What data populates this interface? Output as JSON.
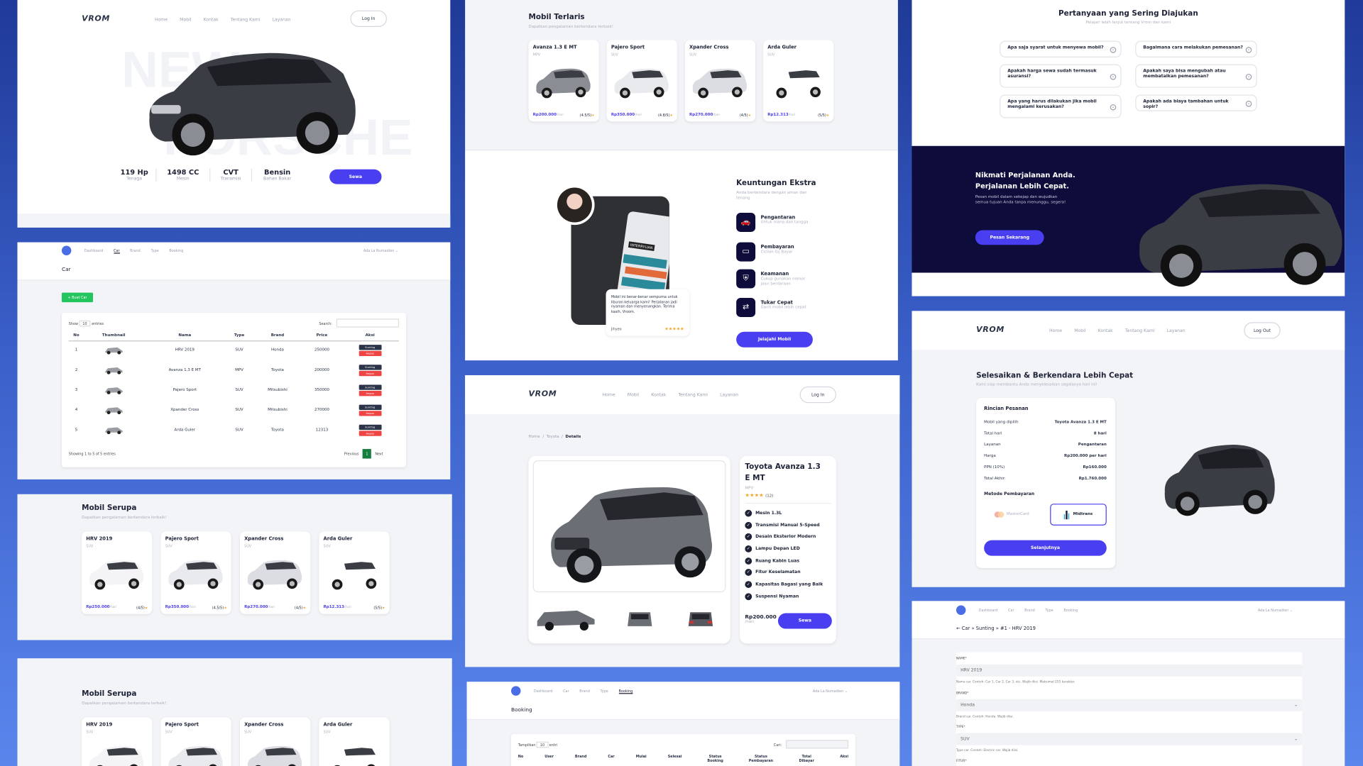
{
  "brand": "VROM",
  "nav": [
    "Home",
    "Mobil",
    "Kontak",
    "Tentang Kami",
    "Layanan"
  ],
  "login": "Log In",
  "logout": "Log Out",
  "hero": {
    "bg_text": [
      "NEW",
      "PORSCHE"
    ],
    "specs": [
      {
        "v": "119 Hp",
        "l": "Tenaga"
      },
      {
        "v": "1498 CC",
        "l": "Mesin"
      },
      {
        "v": "CVT",
        "l": "Transmisi"
      },
      {
        "v": "Bensin",
        "l": "Bahan Bakar"
      }
    ],
    "cta": "Sewa"
  },
  "admin": {
    "nav": [
      "Dashboard",
      "Car",
      "Brand",
      "Type",
      "Booking"
    ],
    "user": "Ada La Numadien",
    "page": "Car",
    "new_btn": "+ Buat Car",
    "show": "Show",
    "entries": "entries",
    "show_n": "10",
    "search": "Search:",
    "cols": [
      "No",
      "Thumbnail",
      "Nama",
      "Type",
      "Brand",
      "Price",
      "Aksi"
    ],
    "rows": [
      [
        "1",
        "HRV 2019",
        "SUV",
        "Honda",
        "250000"
      ],
      [
        "2",
        "Avanza 1.3 E MT",
        "MPV",
        "Toyota",
        "200000"
      ],
      [
        "3",
        "Pajero Sport",
        "SUV",
        "Mitsubishi",
        "350000"
      ],
      [
        "4",
        "Xpander Cross",
        "SUV",
        "Mitsubishi",
        "270000"
      ],
      [
        "5",
        "Arda Guler",
        "SUV",
        "Toyota",
        "12313"
      ]
    ],
    "edit": "Sunting",
    "del": "Hapus",
    "showing": "Showing 1 to 5 of 5 entries",
    "prev": "Previous",
    "page_no": "1",
    "next": "Next"
  },
  "serupa": {
    "title": "Mobil Serupa",
    "sub": "Dapatkan pengalaman berkendara terbaik!",
    "cars": [
      {
        "n": "HRV 2019",
        "t": "SUV",
        "p": "Rp250.000",
        "r": "(4/5)"
      },
      {
        "n": "Pajero Sport",
        "t": "SUV",
        "p": "Rp350.000",
        "r": "(4.5/5)"
      },
      {
        "n": "Xpander Cross",
        "t": "SUV",
        "p": "Rp270.000",
        "r": "(4/5)"
      },
      {
        "n": "Arda Guler",
        "t": "SUV",
        "p": "Rp12.313",
        "r": "(5/5)"
      }
    ],
    "per": "/hari"
  },
  "terlaris": {
    "title": "Mobil Terlaris",
    "sub": "Dapatkan pengalaman berkendara terbaik!",
    "cars": [
      {
        "n": "Avanza 1.3 E MT",
        "t": "MPV",
        "p": "Rp200.000",
        "r": "(4.5/5)"
      },
      {
        "n": "Pajero Sport",
        "t": "SUV",
        "p": "Rp350.000",
        "r": "(4.8/5)"
      },
      {
        "n": "Xpander Cross",
        "t": "SUV",
        "p": "Rp270.000",
        "r": "(4/5)"
      },
      {
        "n": "Arda Guler",
        "t": "SUV",
        "p": "Rp12.313",
        "r": "(5/5)"
      }
    ]
  },
  "keuntungan": {
    "title": "Keuntungan Ekstra",
    "sub": "Anda berkendara dengan aman dan tenang",
    "items": [
      {
        "t": "Pengantaran",
        "s": "Untuk mana dan tangga"
      },
      {
        "t": "Pembayaran",
        "s": "Cicilan Gs Bayar"
      },
      {
        "t": "Keamanan",
        "s": "Cukup gunakan nomor jalur berdaraan"
      },
      {
        "t": "Tukar Cepat",
        "s": "Ganti mobil lebih cepat"
      }
    ],
    "cta": "Jelajahi Mobil",
    "review": "Mobil ini benar-benar sempurna untuk liburan keluarga kami! Perjalanan jadi nyaman dan menyenangkan. Terima kasih, Vroom.",
    "reviewer": "Jihyeo",
    "stars": "★★★★★",
    "sticker": "INTERRYLIAN"
  },
  "detail": {
    "crumbs": [
      "Home",
      "Toyota",
      "Details"
    ],
    "name": "Toyota Avanza 1.3 E MT",
    "type": "MPV",
    "stars": "★★★★",
    "reviews": "(12)",
    "features": [
      "Mesin 1.3L",
      "Transmisi Manual 5-Speed",
      "Desain Eksterior Modern",
      "Lampu Depan LED",
      "Ruang Kabin Luas",
      "Fitur Keselamatan",
      "Kapasitas Bagasi yang Baik",
      "Suspensi Nyaman"
    ],
    "price": "Rp200.000",
    "per": "/hari",
    "cta": "Sewa"
  },
  "booking": {
    "page": "Booking",
    "show": "Tampilkan",
    "show_n": "10",
    "entries": "entri",
    "search": "Cari:",
    "cols": [
      "No",
      "User",
      "Brand",
      "Car",
      "Mulai",
      "Selesai",
      "Status Booking",
      "Status Pembayaran",
      "Total Dibayar",
      "Aksi"
    ]
  },
  "faq": {
    "title": "Pertanyaan yang Sering Diajukan",
    "sub": "Pelajari lebih lanjut tentang Vrom dan kami",
    "items": [
      "Apa saja syarat untuk menyewa mobil?",
      "Bagaimana cara melakukan pemesanan?",
      "Apakah harga sewa sudah termasuk asuransi?",
      "Apakah saya bisa mengubah atau membatalkan pemesanan?",
      "Apa yang harus dilakukan jika mobil mengalami kerusakan?",
      "Apakah ada biaya tambahan untuk sopir?"
    ]
  },
  "promo": {
    "title1": "Nikmati Perjalanan Anda.",
    "title2": "Perjalanan Lebih Cepat.",
    "sub": "Pesan mobil dalam sekejap dan wujudkan semua tujuan Anda tanpa menunggu, segera!",
    "cta": "Pesan Sekarang"
  },
  "checkout": {
    "title": "Selesaikan & Berkendara Lebih Cepat",
    "sub": "Kami siap membantu Anda menyelesaikan segalanya hari ini!",
    "box": "Rincian Pesanan",
    "rows": [
      [
        "Mobil yang dipilih",
        "Toyota Avanza 1.3 E MT"
      ],
      [
        "Total hari",
        "8 hari"
      ],
      [
        "Layanan",
        "Pengantaran"
      ],
      [
        "Harga",
        "Rp200.000 per hari"
      ],
      [
        "PPN (10%)",
        "Rp160.000"
      ],
      [
        "Total Akhir:",
        "Rp1.760.000"
      ]
    ],
    "method": "Metode Pembayaran",
    "pay": [
      "MasterCard",
      "Midtrans"
    ],
    "cta": "Selanjutnya"
  },
  "editform": {
    "crumb": "← Car » Sunting » #1 - HRV 2019",
    "name_l": "NAME*",
    "name_v": "HRV 2019",
    "name_h": "Nama car. Contoh: Car 1, Car 2, Car 3, etc. Wajib diisi. Maksimal 255 karakter.",
    "brand_l": "BRAND*",
    "brand_v": "Honda",
    "brand_h": "Brand car. Contoh: Honda. Wajib diisi.",
    "type_l": "TYPE*",
    "type_v": "SUV",
    "type_h": "Type car. Contoh: Electric car. Wajib diisi.",
    "fitur_l": "FITUR*"
  },
  "colors": {
    "accent": "#4a3ff0",
    "navy": "#0d0c3a",
    "danger": "#ef4444",
    "green": "#22c55e"
  }
}
